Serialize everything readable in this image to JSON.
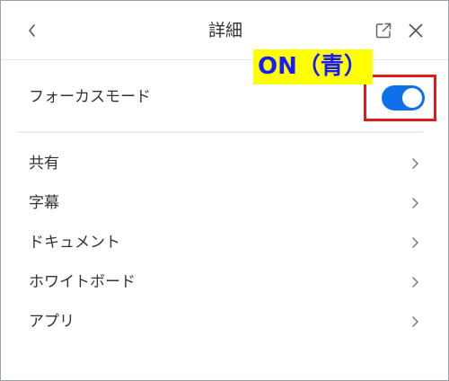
{
  "header": {
    "title": "詳細",
    "back_icon": "chevron-left-icon",
    "popout_icon": "popout-icon",
    "close_icon": "close-icon"
  },
  "annotation": {
    "label": "ON（青）",
    "label_bg": "#ffff00",
    "label_color": "#1a1aff",
    "box_color": "#e01b1b"
  },
  "focus_mode": {
    "label": "フォーカスモード",
    "toggle_state": "on",
    "toggle_color": "#0e71eb"
  },
  "menu": {
    "items": [
      {
        "label": "共有"
      },
      {
        "label": "字幕"
      },
      {
        "label": "ドキュメント"
      },
      {
        "label": "ホワイトボード"
      },
      {
        "label": "アプリ"
      }
    ]
  }
}
